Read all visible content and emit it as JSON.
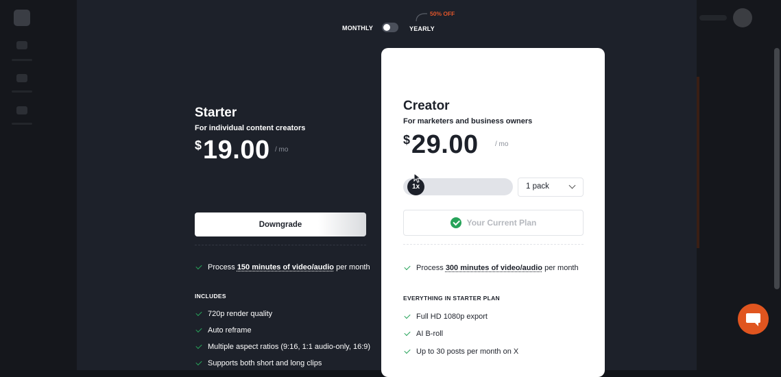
{
  "billing": {
    "monthly_label": "MONTHLY",
    "yearly_label": "YEARLY",
    "discount_label": "50% OFF",
    "yearly_selected": false
  },
  "plans": [
    {
      "name": "Starter",
      "subtitle": "For individual content creators",
      "currency": "$",
      "price": "19.00",
      "period": "/ mo",
      "action_label": "Downgrade",
      "primary_feature": {
        "prefix": "Process ",
        "highlight": "150 minutes of video/audio",
        "suffix": " per month"
      },
      "section_title": "INCLUDES",
      "features": [
        "720p render quality",
        "Auto reframe",
        "Multiple aspect ratios (9:16, 1:1 audio-only, 16:9)",
        "Supports both short and long clips"
      ]
    },
    {
      "name": "Creator",
      "subtitle": "For marketers and business owners",
      "currency": "$",
      "price": "29.00",
      "period": "/ mo",
      "multiplier": "1x",
      "pack_select": "1 pack",
      "status_label": "Your Current Plan",
      "primary_feature": {
        "prefix": "Process ",
        "highlight": "300 minutes of video/audio",
        "suffix": " per month"
      },
      "section_title": "EVERYTHING IN STARTER PLAN",
      "features": [
        "Full HD 1080p export",
        "AI B-roll",
        "Up to 30 posts per month on X"
      ]
    }
  ],
  "colors": {
    "accent": "#e0551f",
    "discount": "#e0552a",
    "check": "#27a35a",
    "modal_bg": "#1d212a"
  },
  "icons": {
    "chat": "chat-bubble-icon",
    "check": "checkmark-icon",
    "chevron": "chevron-down-icon"
  }
}
